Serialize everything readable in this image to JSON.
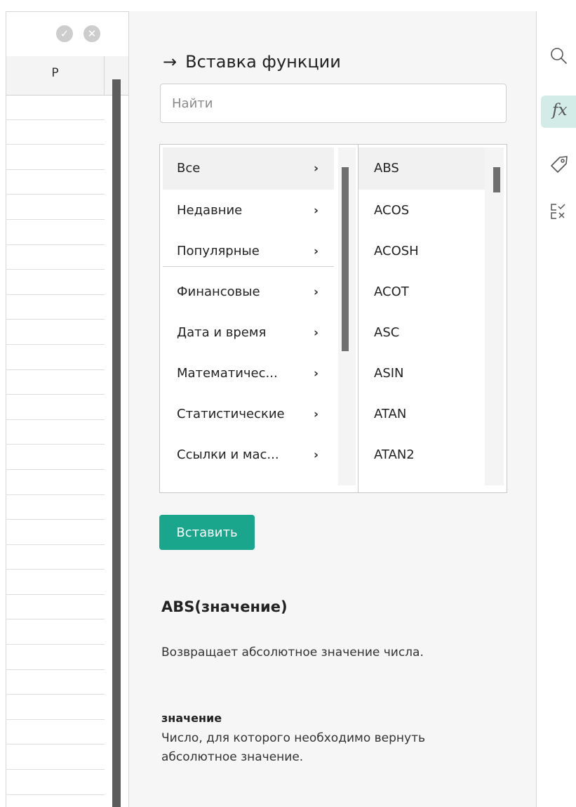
{
  "sheet": {
    "column_label": "P",
    "confirm_icon": "check-circle-icon",
    "cancel_icon": "close-circle-icon"
  },
  "panel": {
    "title": "Вставка функции",
    "title_icon": "arrow-right-icon",
    "search_placeholder": "Найти",
    "categories": [
      {
        "label": "Все",
        "selected": true
      },
      {
        "label": "Недавние",
        "selected": false
      },
      {
        "label": "Популярные",
        "selected": false
      },
      {
        "label": "Финансовые",
        "selected": false
      },
      {
        "label": "Дата и время",
        "selected": false
      },
      {
        "label": "Математичес...",
        "selected": false
      },
      {
        "label": "Статистические",
        "selected": false
      },
      {
        "label": "Ссылки и мас...",
        "selected": false
      }
    ],
    "functions": [
      {
        "label": "ABS",
        "selected": true
      },
      {
        "label": "ACOS",
        "selected": false
      },
      {
        "label": "ACOSH",
        "selected": false
      },
      {
        "label": "ACOT",
        "selected": false
      },
      {
        "label": "ASC",
        "selected": false
      },
      {
        "label": "ASIN",
        "selected": false
      },
      {
        "label": "ATAN",
        "selected": false
      },
      {
        "label": "ATAN2",
        "selected": false
      }
    ],
    "insert_button": "Вставить",
    "description": {
      "signature": "ABS(значение)",
      "text": "Возвращает абсолютное значение числа.",
      "arg_name": "значение",
      "arg_text": "Число, для которого необходимо вернуть абсолютное значение."
    }
  },
  "toolbar": {
    "items": [
      {
        "icon": "search-icon",
        "active": false
      },
      {
        "icon": "function-icon",
        "label": "fx",
        "active": true
      },
      {
        "icon": "tag-icon",
        "active": false
      },
      {
        "icon": "check-cross-list-icon",
        "active": false
      }
    ]
  },
  "colors": {
    "accent": "#1aa68c",
    "accent_light": "#d3ece7",
    "panel_bg": "#f6f6f6",
    "scrollbar": "#6f6f6f"
  }
}
